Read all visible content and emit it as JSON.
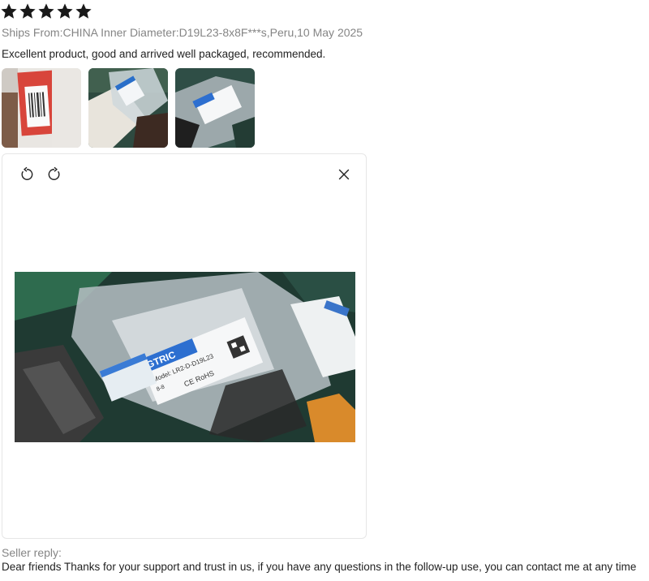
{
  "rating": {
    "value": 5,
    "max": 5,
    "color": "#191919"
  },
  "review": {
    "meta": "Ships From:CHINA Inner Diameter:D19L23-8x8F***s,Peru,10 May 2025",
    "text": "Excellent product, good and arrived well packaged, recommended."
  },
  "thumbnails": [
    {
      "icon": "package-photo"
    },
    {
      "icon": "package-photo"
    },
    {
      "icon": "package-photo"
    }
  ],
  "viewer": {
    "rotate_left_icon": "rotate-left-icon",
    "rotate_right_icon": "rotate-right-icon",
    "close_icon": "close-icon",
    "label": {
      "brand": "GTRIC",
      "model": "Model: LR2-D-D19L23",
      "spec": "8-8",
      "marks": "CE RoHS"
    }
  },
  "seller_reply": {
    "label": "Seller reply:",
    "text": "Dear friends Thanks for your support and trust in us, if you have any questions in the follow-up use, you can contact me at any time"
  }
}
